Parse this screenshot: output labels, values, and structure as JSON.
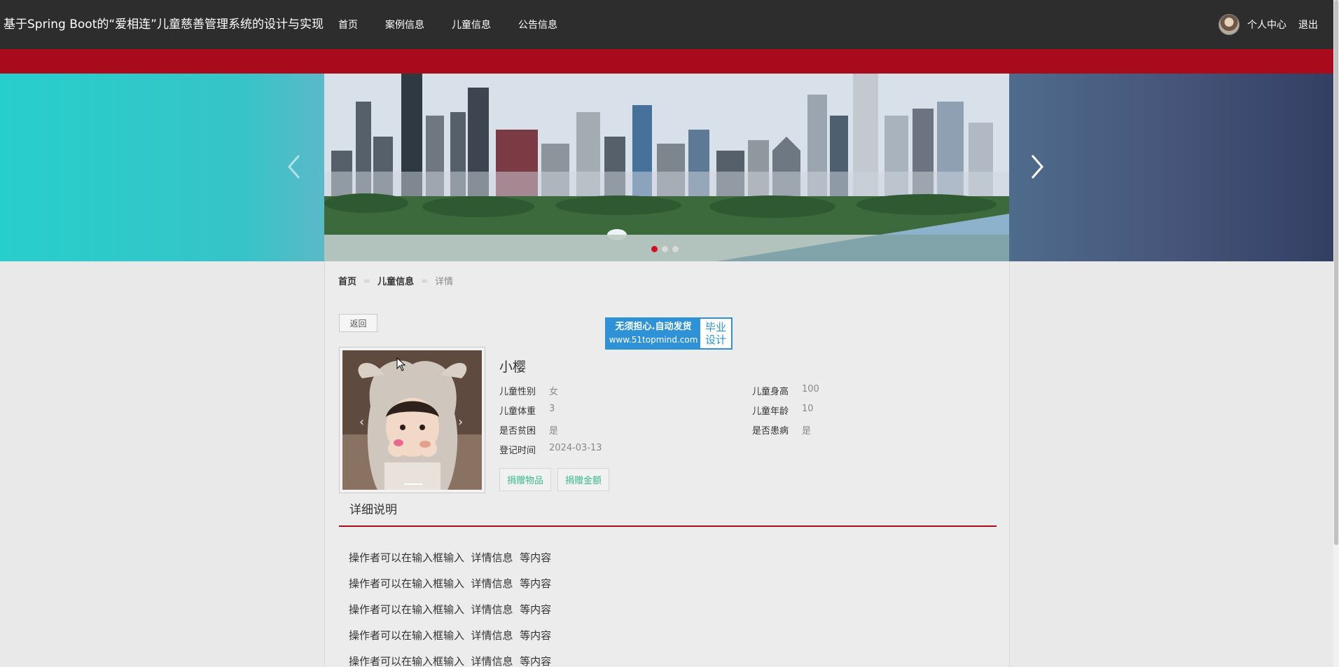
{
  "header": {
    "site_title": "基于Spring Boot的“爱相连”儿童慈善管理系统的设计与实现",
    "nav": [
      "首页",
      "案例信息",
      "儿童信息",
      "公告信息"
    ],
    "user_center": "个人中心",
    "logout": "退出"
  },
  "banner": {
    "slide_count": 3,
    "active_slide": 1
  },
  "breadcrumb": {
    "home": "首页",
    "section": "儿童信息",
    "current": "详情"
  },
  "back_label": "返回",
  "watermark": {
    "line1": "无须担心.自动发货",
    "line2": "www.51topmind.com",
    "side1": "毕业",
    "side2": "设计"
  },
  "child": {
    "name": "小樱",
    "fields": [
      {
        "label": "儿童性别",
        "value": "女"
      },
      {
        "label": "儿童身高",
        "value": "100"
      },
      {
        "label": "儿童体重",
        "value": "3"
      },
      {
        "label": "儿童年龄",
        "value": "10"
      },
      {
        "label": "是否贫困",
        "value": "是"
      },
      {
        "label": "是否患病",
        "value": "是"
      },
      {
        "label": "登记时间",
        "value": "2024-03-13"
      }
    ],
    "actions": [
      "捐赠物品",
      "捐赠金额"
    ]
  },
  "detail": {
    "title": "详细说明",
    "lines": [
      "操作者可以在输入框输入  详情信息  等内容",
      "操作者可以在输入框输入  详情信息  等内容",
      "操作者可以在输入框输入  详情信息  等内容",
      "操作者可以在输入框输入  详情信息  等内容",
      "操作者可以在输入框输入  详情信息  等内容"
    ]
  }
}
